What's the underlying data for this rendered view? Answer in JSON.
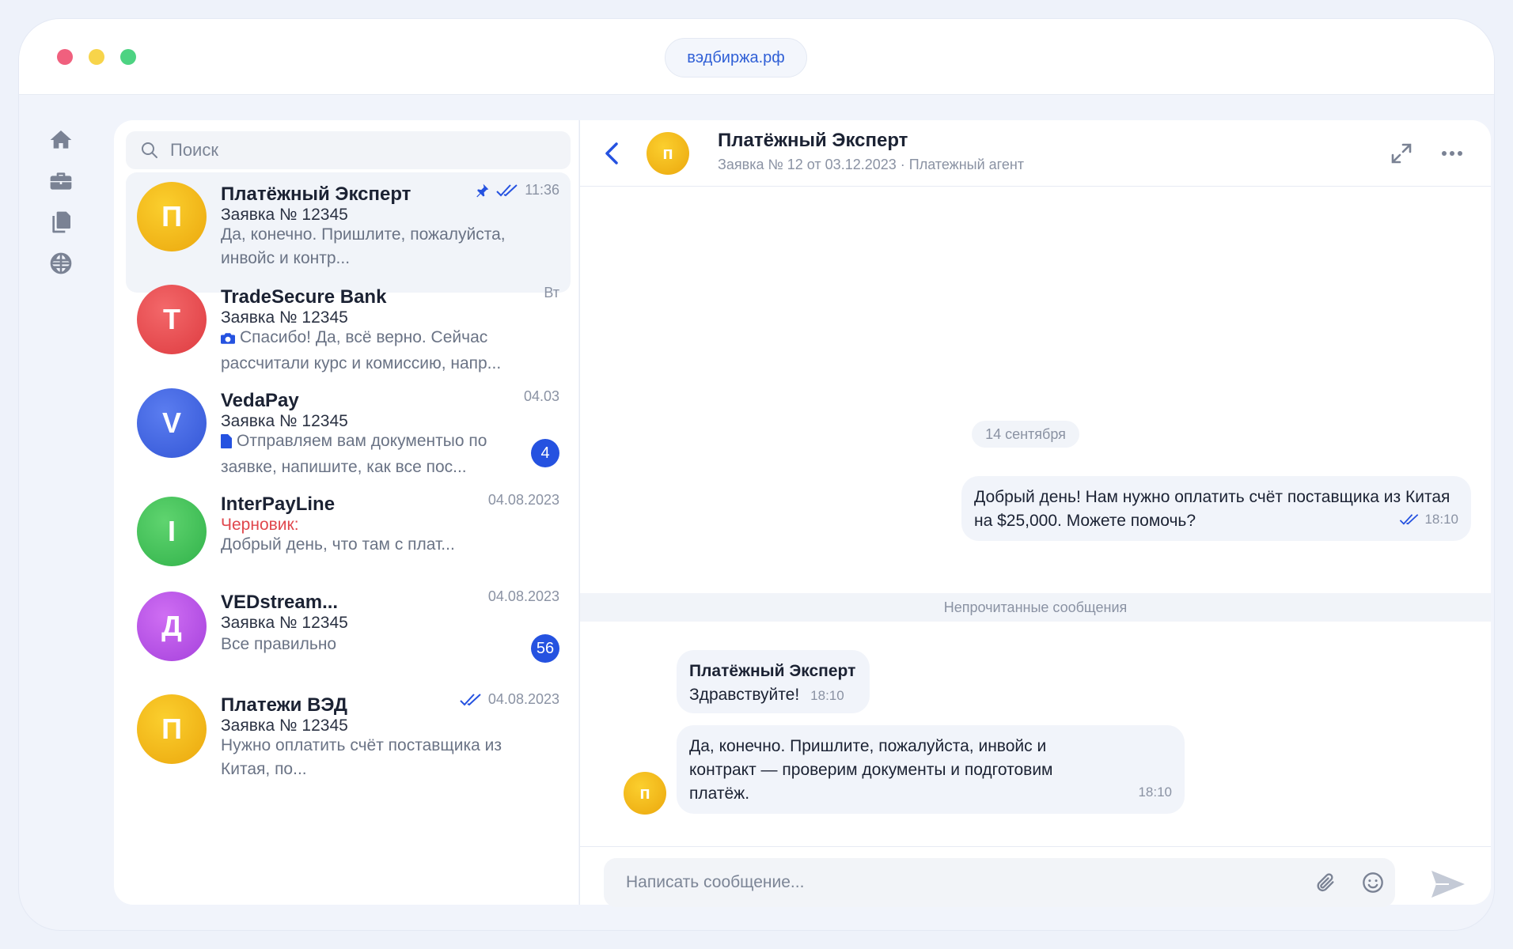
{
  "window": {
    "url": "вэдбиржа.рф"
  },
  "search": {
    "placeholder": "Поиск"
  },
  "chats": [
    {
      "initial": "П",
      "name": "Платёжный Эксперт",
      "subtitle": "Заявка № 12345",
      "preview": "Да, конечно. Пришлите, пожалуйста, инвойс и контр...",
      "time": "11:36",
      "pinned": true,
      "read": true,
      "active": true
    },
    {
      "initial": "T",
      "name": "TradeSecure Bank",
      "subtitle": "Заявка № 12345",
      "preview": "Спасибо! Да, всё верно. Сейчас рассчитали курс и комиссию, напр...",
      "preview_icon": "camera-icon",
      "time": "Вт"
    },
    {
      "initial": "V",
      "name": "VedaPay",
      "subtitle": "Заявка № 12345",
      "preview": "Отправляем вам документыо по заявке, напишите, как все пос...",
      "preview_icon": "document-icon",
      "time": "04.03",
      "unread": "4"
    },
    {
      "initial": "I",
      "name": "InterPayLine",
      "subtitle": "Черновик:",
      "preview": "Добрый день, что там с плат...",
      "time": "04.08.2023"
    },
    {
      "initial": "Д",
      "name": "VEDstream...",
      "subtitle": "Заявка № 12345",
      "preview": "Все правильно",
      "time": "04.08.2023",
      "unread": "56"
    },
    {
      "initial": "П",
      "name": "Платежи ВЭД",
      "subtitle": "Заявка № 12345",
      "preview": "Нужно оплатить счёт поставщика из Китая, по...",
      "time": "04.08.2023",
      "read": true
    }
  ],
  "chat": {
    "avatar_initial": "п",
    "title": "Платёжный Эксперт",
    "subtitle": "Заявка № 12 от 03.12.2023 · Платежный агент",
    "date_divider": "14 сентября",
    "unread_divider": "Непрочитанные сообщения",
    "messages": [
      {
        "direction": "out",
        "text": "Добрый день! Нам нужно оплатить счёт поставщика из Китая на $25,000. Можете помочь?",
        "time": "18:10",
        "read": true
      },
      {
        "direction": "in",
        "sender": "Платёжный Эксперт",
        "text": "Здравствуйте!",
        "time": "18:10"
      },
      {
        "direction": "in",
        "text": "Да, конечно. Пришлите, пожалуйста, инвойс и контракт — проверим документы и подготовим платёж.",
        "time": "18:10"
      }
    ],
    "composer_placeholder": "Написать сообщение..."
  },
  "colors": {
    "accent": "#2552e0",
    "avatar_yellow": "#f2b81c",
    "avatar_red": "#e54a4e",
    "avatar_blue": "#4468e3",
    "avatar_green": "#45c35c",
    "avatar_purple": "#bb58e8",
    "draft_red": "#e0474d"
  }
}
